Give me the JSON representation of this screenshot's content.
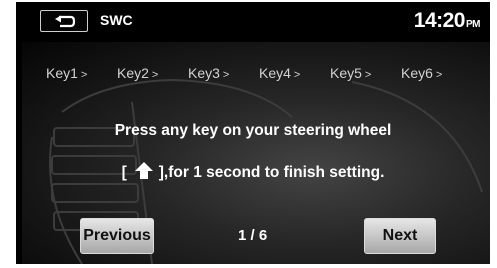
{
  "header": {
    "back_icon": "back-arrow-icon",
    "title": "SWC",
    "clock_time": "14:20",
    "clock_ampm": "PM"
  },
  "keys": [
    {
      "label": "Key1",
      "chevron": ">"
    },
    {
      "label": "Key2",
      "chevron": ">"
    },
    {
      "label": "Key3",
      "chevron": ">"
    },
    {
      "label": "Key4",
      "chevron": ">"
    },
    {
      "label": "Key5",
      "chevron": ">"
    },
    {
      "label": "Key6",
      "chevron": ">"
    }
  ],
  "instructions": {
    "line1": "Press any key on your steering wheel",
    "line2_open": "[",
    "line2_icon": "home-icon",
    "line2_rest": "],for 1 second to finish setting."
  },
  "footer": {
    "previous_label": "Previous",
    "page_indicator": "1 / 6",
    "next_label": "Next"
  }
}
